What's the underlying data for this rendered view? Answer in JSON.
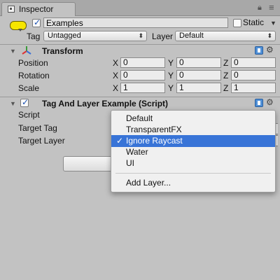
{
  "tab": {
    "title": "Inspector"
  },
  "header": {
    "active": true,
    "name": "Examples",
    "static_label": "Static",
    "static_checked": false,
    "tag_label": "Tag",
    "tag_value": "Untagged",
    "layer_label": "Layer",
    "layer_value": "Default"
  },
  "transform": {
    "title": "Transform",
    "rows": [
      {
        "label": "Position",
        "x": "0",
        "y": "0",
        "z": "0"
      },
      {
        "label": "Rotation",
        "x": "0",
        "y": "0",
        "z": "0"
      },
      {
        "label": "Scale",
        "x": "1",
        "y": "1",
        "z": "1"
      }
    ],
    "axes": {
      "x": "X",
      "y": "Y",
      "z": "Z"
    }
  },
  "script_component": {
    "enabled": true,
    "title": "Tag And Layer Example (Script)",
    "props": [
      {
        "label": "Script"
      },
      {
        "label": "Target Tag"
      },
      {
        "label": "Target Layer"
      }
    ]
  },
  "layer_menu": {
    "items": [
      "Default",
      "TransparentFX",
      "Ignore Raycast",
      "Water",
      "UI"
    ],
    "selected_index": 2,
    "check_glyph": "✓",
    "add_label": "Add Layer..."
  },
  "colors": {
    "panel_bg": "#c2c2c2",
    "selection": "#3874d7",
    "gameobject_icon": "#f6e600"
  }
}
